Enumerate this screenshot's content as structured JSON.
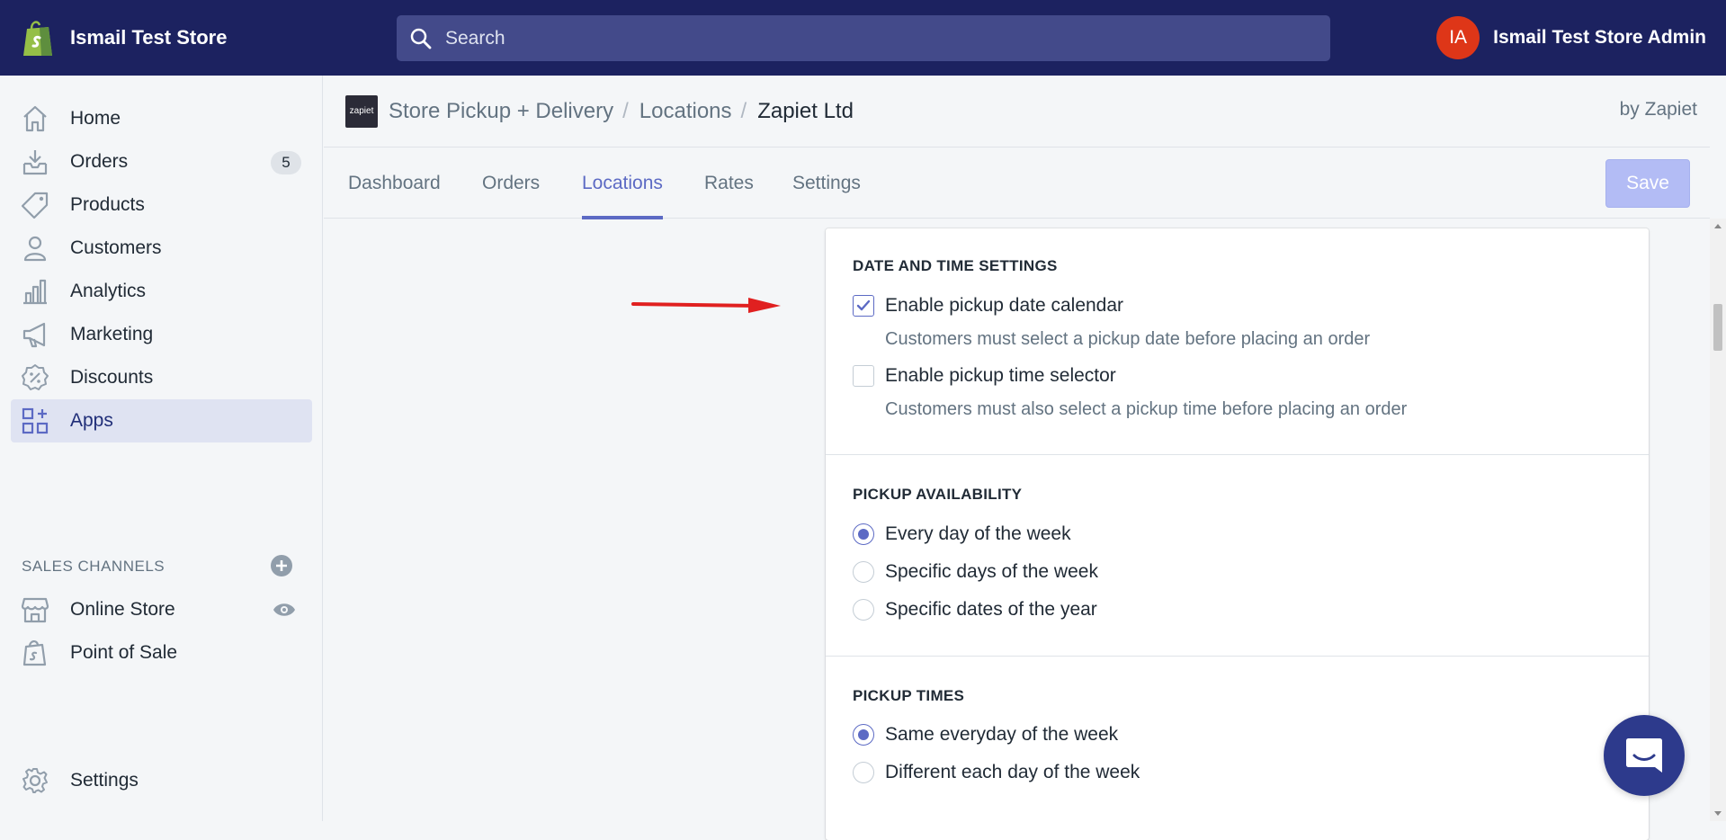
{
  "topbar": {
    "store_name": "Ismail Test Store",
    "search_placeholder": "Search",
    "avatar_initials": "IA",
    "account_name": "Ismail Test Store Admin"
  },
  "sidebar": {
    "items": [
      {
        "label": "Home",
        "icon": "home-icon"
      },
      {
        "label": "Orders",
        "icon": "orders-icon",
        "badge": "5"
      },
      {
        "label": "Products",
        "icon": "tag-icon"
      },
      {
        "label": "Customers",
        "icon": "person-icon"
      },
      {
        "label": "Analytics",
        "icon": "bar-chart-icon"
      },
      {
        "label": "Marketing",
        "icon": "megaphone-icon"
      },
      {
        "label": "Discounts",
        "icon": "discount-icon"
      },
      {
        "label": "Apps",
        "icon": "apps-icon",
        "active": true
      }
    ],
    "sales_channels_heading": "SALES CHANNELS",
    "channels": [
      {
        "label": "Online Store",
        "icon": "store-icon"
      },
      {
        "label": "Point of Sale",
        "icon": "pos-bag-icon"
      }
    ],
    "settings_label": "Settings"
  },
  "app_header": {
    "logo_text": "zapiet",
    "breadcrumb": [
      "Store Pickup + Delivery",
      "Locations",
      "Zapiet Ltd"
    ],
    "separator": "/",
    "by_vendor": "by Zapiet"
  },
  "tabs": [
    {
      "label": "Dashboard"
    },
    {
      "label": "Orders"
    },
    {
      "label": "Locations",
      "active": true
    },
    {
      "label": "Rates"
    },
    {
      "label": "Settings"
    }
  ],
  "save_label": "Save",
  "card": {
    "date_time": {
      "title": "DATE AND TIME SETTINGS",
      "options": [
        {
          "label": "Enable pickup date calendar",
          "help": "Customers must select a pickup date before placing an order",
          "checked": true
        },
        {
          "label": "Enable pickup time selector",
          "help": "Customers must also select a pickup time before placing an order",
          "checked": false
        }
      ]
    },
    "availability": {
      "title": "PICKUP AVAILABILITY",
      "options": [
        {
          "label": "Every day of the week",
          "checked": true
        },
        {
          "label": "Specific days of the week",
          "checked": false
        },
        {
          "label": "Specific dates of the year",
          "checked": false
        }
      ]
    },
    "times": {
      "title": "PICKUP TIMES",
      "options": [
        {
          "label": "Same everyday of the week",
          "checked": true
        },
        {
          "label": "Different each day of the week",
          "checked": false
        }
      ]
    }
  },
  "colors": {
    "topbar": "#1c2260",
    "accent": "#5c6ac4",
    "avatar": "#de3618",
    "arrow": "#e02020"
  }
}
